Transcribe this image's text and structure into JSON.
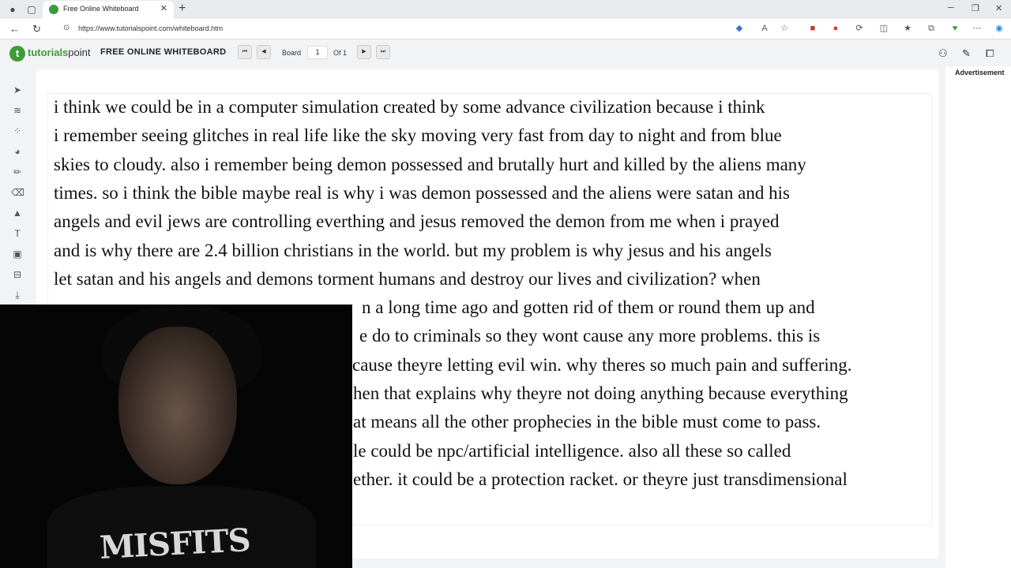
{
  "browser": {
    "tab_title": "Free Online Whiteboard",
    "url": "https://www.tutorialspoint.com/whiteboard.htm"
  },
  "site": {
    "logo_brand": "tutorials",
    "logo_suffix": "point",
    "title": "FREE ONLINE WHITEBOARD",
    "board_label": "Board",
    "board_value": "1",
    "of_label": "Of 1"
  },
  "ad": {
    "label": "Advertisement"
  },
  "canvas": {
    "lines": [
      "i think we could be in a computer simulation created by some advance civilization because i think",
      "i remember seeing glitches in real life like the sky moving very fast from day to night and from blue",
      "skies to cloudy. also i remember being demon possessed and brutally hurt and killed by the aliens many",
      "times. so i think the bible maybe real is why i was demon possessed and the aliens were satan and his",
      "angels and evil jews are controlling everthing and jesus removed the demon from me when i prayed",
      "and is why there are 2.4 billion christians in the world. but my problem is why jesus and his angels",
      "let satan and his angels and demons torment humans and destroy our lives and civilization? when",
      "n a long time ago and gotten rid of them or round them up and",
      "e do to criminals so they wont cause any more problems. this is",
      "cause theyre letting evil win. why theres so much pain and suffering.",
      "hen that explains why theyre not doing anything because everything",
      "at means all the other prophecies in the bible must come to pass.",
      "le could be npc/artificial intelligence. also all these so called",
      "ether. it could be a protection racket. or theyre just transdimensional"
    ]
  },
  "webcam": {
    "shirt_text": "MISFITS"
  }
}
